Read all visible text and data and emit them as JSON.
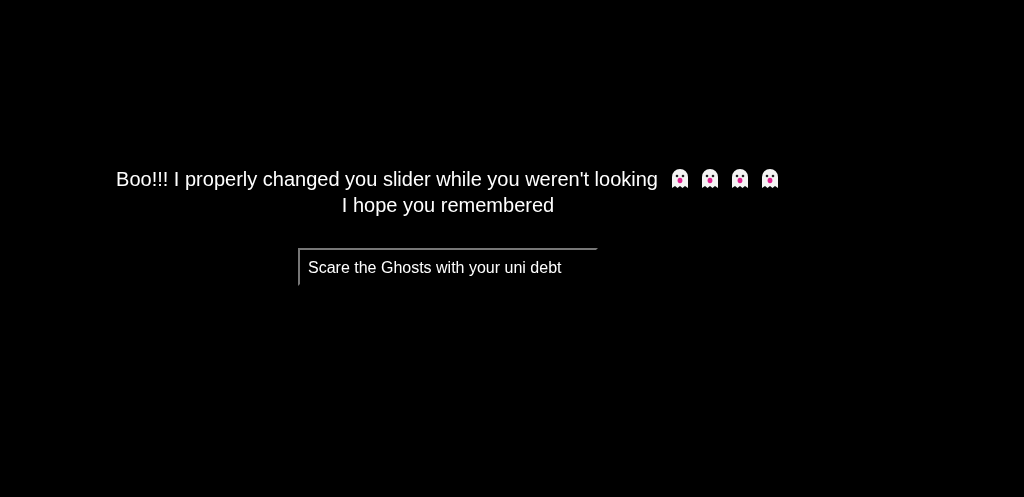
{
  "message": {
    "lines": [
      "Boo!!! I properly changed you slider while you weren't looking",
      "I hope you remembered"
    ],
    "icons": [
      {
        "kind": "ghost"
      },
      {
        "kind": "ghost"
      },
      {
        "kind": "ghost"
      },
      {
        "kind": "ghost"
      }
    ]
  },
  "field": {
    "value": "Scare the Ghosts with your uni debt"
  }
}
